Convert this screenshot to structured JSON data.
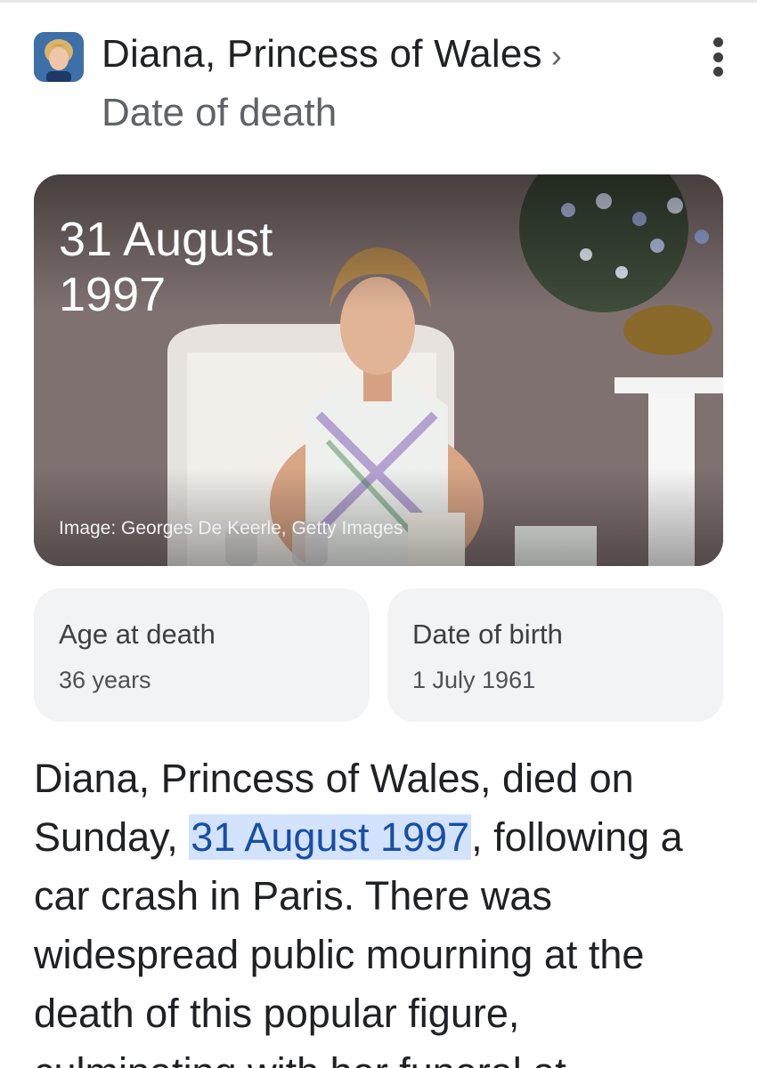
{
  "header": {
    "entity_name": "Diana, Princess of Wales",
    "chevron": "›",
    "attribute": "Date of death",
    "avatar_icon": "portrait-thumbnail",
    "more_icon": "more-vert-icon"
  },
  "hero": {
    "date_text": "31 August 1997",
    "credit": "Image: Georges De Keerle, Getty Images"
  },
  "chips": [
    {
      "label": "Age at death",
      "value": "36 years"
    },
    {
      "label": "Date of birth",
      "value": "1 July 1961"
    }
  ],
  "description": {
    "before": "Diana, Princess of Wales, died on Sunday, ",
    "highlight": "31 August 1997",
    "after": ", following a car crash in Paris. There was widespread public mourning at the death of this popular figure, culminating with her funeral at"
  },
  "colors": {
    "highlight_bg": "#d3e3fd",
    "highlight_text": "#174ea6",
    "chip_bg": "#f1f3f4"
  }
}
